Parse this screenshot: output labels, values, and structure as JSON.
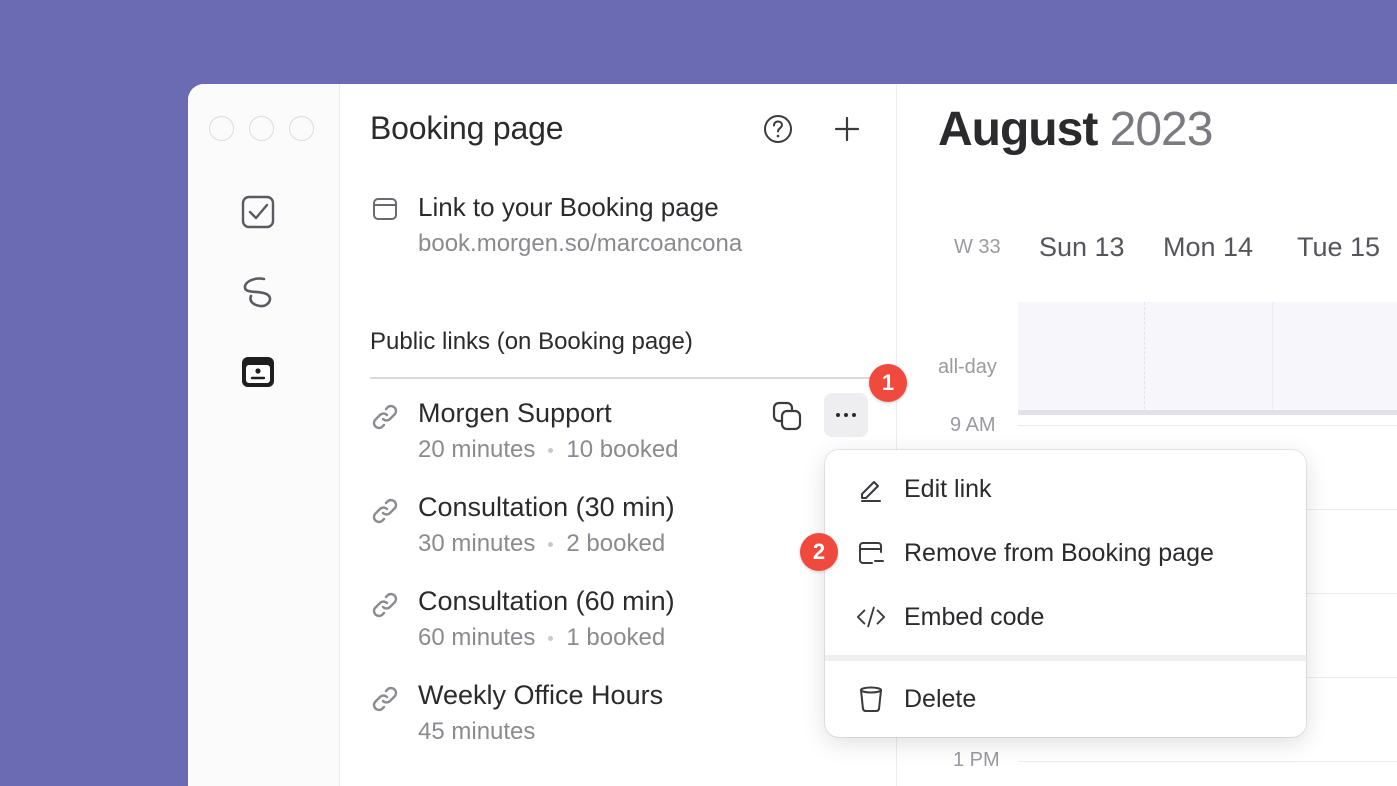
{
  "sidebar": {
    "icons": [
      "checkbox-icon",
      "link-loop-icon",
      "booking-calendar-icon"
    ]
  },
  "panel": {
    "title": "Booking page",
    "booking_link": {
      "title": "Link to your Booking page",
      "url": "book.morgen.so/marcoancona"
    },
    "section_title": "Public links (on Booking page)",
    "links": [
      {
        "name": "Morgen Support",
        "duration": "20 minutes",
        "booked": "10 booked"
      },
      {
        "name": "Consultation (30 min)",
        "duration": "30 minutes",
        "booked": "2 booked"
      },
      {
        "name": "Consultation (60 min)",
        "duration": "60 minutes",
        "booked": "1 booked"
      },
      {
        "name": "Weekly Office Hours",
        "duration": "45 minutes"
      }
    ]
  },
  "calendar": {
    "month": "August",
    "year": "2023",
    "week": "W 33",
    "days": [
      "Sun 13",
      "Mon 14",
      "Tue 15"
    ],
    "allday_label": "all-day",
    "times": [
      "9 AM",
      "1 PM"
    ]
  },
  "menu": {
    "items": [
      {
        "label": "Edit link",
        "icon": "pencil-icon"
      },
      {
        "label": "Remove from Booking page",
        "icon": "remove-window-icon"
      },
      {
        "label": "Embed code",
        "icon": "code-icon"
      },
      {
        "label": "Delete",
        "icon": "trash-icon"
      }
    ]
  },
  "badges": [
    "1",
    "2"
  ],
  "colors": {
    "background": "#6a6bb3",
    "badge": "#f04a3f",
    "text": "#2b2b2e",
    "muted": "#8a8a90"
  }
}
